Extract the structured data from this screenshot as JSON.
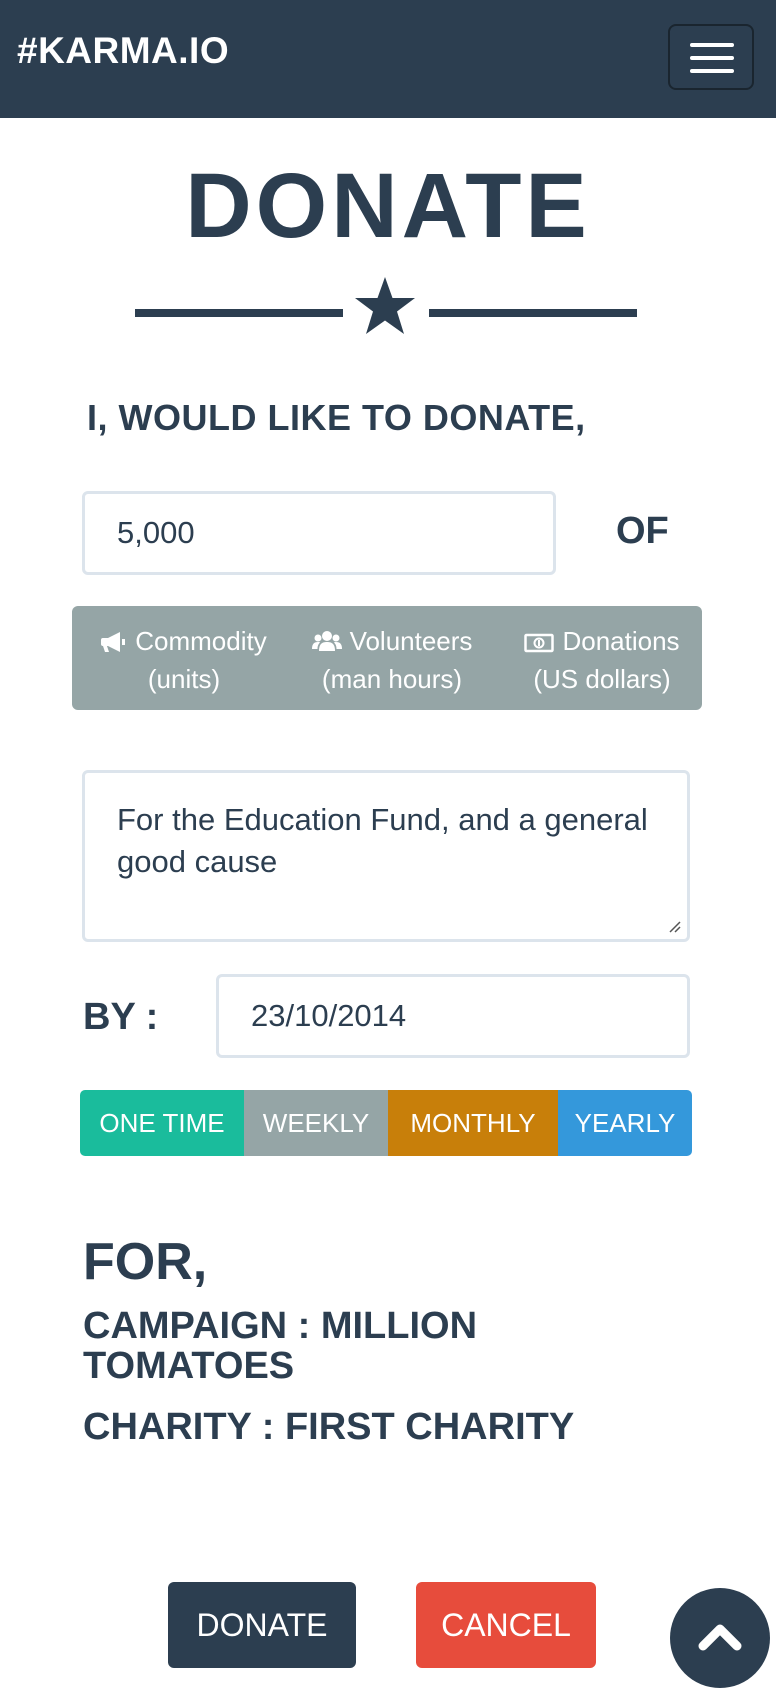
{
  "navbar": {
    "brand": "#KARMA.IO",
    "menu_icon": "hamburger-menu-icon"
  },
  "page": {
    "title": "DONATE",
    "star_icon": "star-icon"
  },
  "form": {
    "heading": "I, WOULD LIKE TO DONATE,",
    "amount_value": "5,000",
    "of_label": "OF",
    "units": [
      {
        "icon": "megaphone-icon",
        "label": "Commodity",
        "sub": "(units)"
      },
      {
        "icon": "users-icon",
        "label": "Volunteers",
        "sub": "(man hours)"
      },
      {
        "icon": "money-icon",
        "label": "Donations",
        "sub": "(US dollars)"
      }
    ],
    "purpose_value": "For the Education Fund, and a general good cause",
    "by_label": "BY :",
    "date_value": "23/10/2014",
    "frequency": [
      {
        "label": "ONE TIME",
        "color": "#1abc9c"
      },
      {
        "label": "WEEKLY",
        "color": "#95a5a6"
      },
      {
        "label": "MONTHLY",
        "color": "#c87f0a"
      },
      {
        "label": "YEARLY",
        "color": "#3498db"
      }
    ]
  },
  "target": {
    "for_label": "FOR,",
    "campaign": "CAMPAIGN : MILLION TOMATOES",
    "charity": "CHARITY : FIRST CHARITY"
  },
  "actions": {
    "donate_label": "DONATE",
    "cancel_label": "CANCEL",
    "scroll_top_icon": "chevron-up-icon"
  },
  "colors": {
    "primary": "#2c3e50",
    "danger": "#e74c3c",
    "muted": "#95a5a6"
  }
}
